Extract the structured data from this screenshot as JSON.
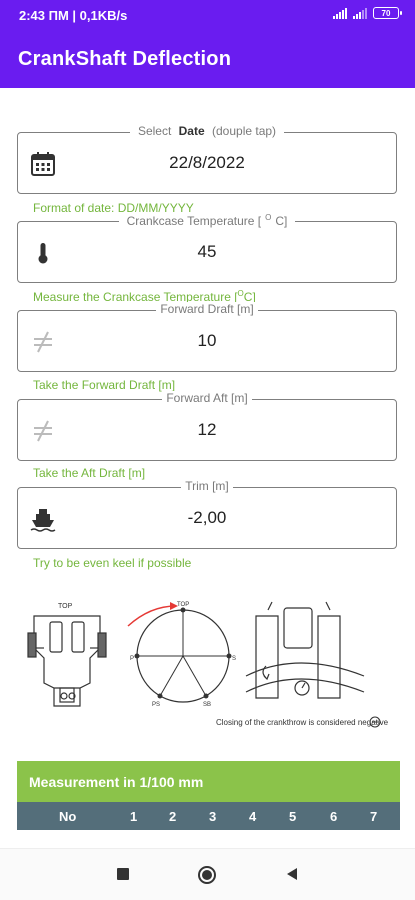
{
  "status_bar": {
    "time": "2:43 ПМ | 0,1KB/s",
    "battery": "70"
  },
  "app_bar": {
    "title": "CrankShaft Deflection"
  },
  "fields": {
    "date": {
      "label_prefix": "Select",
      "label_bold": "Date",
      "label_suffix": "(douple tap)",
      "value": "22/8/2022",
      "icon": "calendar-icon",
      "hint": "Format of date: DD/MM/YYYY"
    },
    "temperature": {
      "label": "Crankcase Temperature [",
      "label_sup": "O",
      "label_end": "C]",
      "value": "45",
      "icon": "thermometer-icon",
      "hint": "Measure the Crankcase Temperature [",
      "hint_sup": "O",
      "hint_end": "C]"
    },
    "forward_draft": {
      "label": "Forward Draft [m]",
      "value": "10",
      "icon": "not-equal-icon",
      "hint": "Take the Forward Draft [m]"
    },
    "aft_draft": {
      "label": "Forward Aft [m]",
      "value": "12",
      "icon": "not-equal-icon",
      "hint": "Take the Aft Draft [m]"
    },
    "trim": {
      "label": "Trim [m]",
      "value": "-2,00",
      "icon": "ship-icon",
      "hint": "Try to be even keel if possible"
    }
  },
  "diagram": {
    "top_label_left": "TOP",
    "top_label_circle": "TOP",
    "labels": {
      "p": "P",
      "s": "S",
      "ps": "PS",
      "sb": "SB"
    },
    "caption": "Closing of the crankthrow is considered negative"
  },
  "measurement": {
    "title": "Measurement in 1/100 mm",
    "columns": [
      "No",
      "1",
      "2",
      "3",
      "4",
      "5",
      "6",
      "7"
    ]
  },
  "colors": {
    "primary": "#6a1cf0",
    "accent": "#8bc34a",
    "hint": "#74b63d",
    "table_header": "#546e7a"
  }
}
